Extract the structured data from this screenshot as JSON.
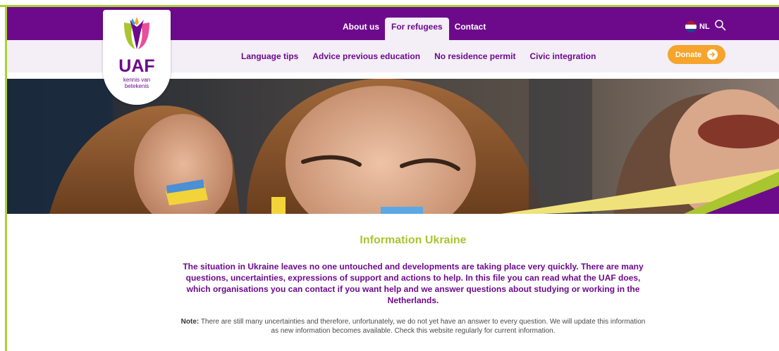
{
  "brand": {
    "name": "UAF",
    "tagline_line1": "kennis van",
    "tagline_line2": "betekenis"
  },
  "main_nav": {
    "items": [
      {
        "label": "About us",
        "active": false
      },
      {
        "label": "For refugees",
        "active": true
      },
      {
        "label": "Contact",
        "active": false
      }
    ]
  },
  "language": {
    "label": "NL",
    "flag": "dutch-flag-icon"
  },
  "search": {
    "icon": "search-icon"
  },
  "sub_nav": {
    "items": [
      {
        "label": "Language tips"
      },
      {
        "label": "Advice previous education"
      },
      {
        "label": "No residence permit"
      },
      {
        "label": "Civic integration"
      }
    ]
  },
  "donate": {
    "label": "Donate",
    "icon": "arrow-right-icon"
  },
  "article": {
    "title": "Information Ukraine",
    "intro": "The situation in Ukraine leaves no one untouched and developments are taking place very quickly. There are many questions, uncertainties, expressions of support and actions to help. In this file you can read what the UAF does, which organisations you can contact if you want help and we answer questions about studying or working in the Netherlands.",
    "note_label": "Note:",
    "note_text": " There are still many uncertainties and therefore, unfortunately, we do not yet have an answer to every question. We will update this information as new information becomes available. Check this website regularly for current information."
  },
  "colors": {
    "brand_purple": "#6d0a8c",
    "accent_green": "#a9c52f",
    "donate_orange": "#f6a42c",
    "subbar_bg": "#f4eef7"
  }
}
